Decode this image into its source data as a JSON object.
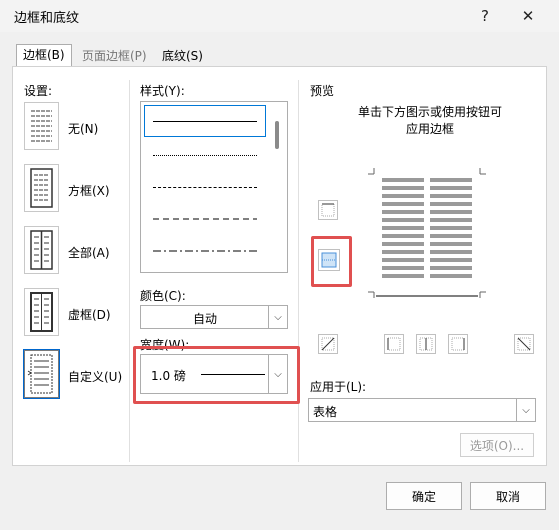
{
  "window": {
    "title": "边框和底纹",
    "help_glyph": "?",
    "close_glyph": "✕"
  },
  "tabs": [
    {
      "label": "边框(B)",
      "active": true
    },
    {
      "label": "页面边框(P)",
      "active": false
    },
    {
      "label": "底纹(S)",
      "active": false
    }
  ],
  "settings": {
    "label": "设置:",
    "items": [
      {
        "label": "无(N)",
        "icon": "setting-none-icon"
      },
      {
        "label": "方框(X)",
        "icon": "setting-box-icon"
      },
      {
        "label": "全部(A)",
        "icon": "setting-all-icon"
      },
      {
        "label": "虚框(D)",
        "icon": "setting-grid-icon"
      },
      {
        "label": "自定义(U)",
        "icon": "setting-custom-icon",
        "selected": true
      }
    ]
  },
  "style": {
    "label": "样式(Y):"
  },
  "color": {
    "label": "颜色(C):",
    "value": "自动"
  },
  "width": {
    "label": "宽度(W):",
    "value": "1.0 磅"
  },
  "preview": {
    "label": "预览",
    "hint_line1": "单击下方图示或使用按钮可",
    "hint_line2": "应用边框"
  },
  "apply_to": {
    "label": "应用于(L):",
    "value": "表格"
  },
  "options_button": "选项(O)...",
  "ok_button": "确定",
  "cancel_button": "取消",
  "colors": {
    "accent": "#0078d7",
    "highlight_red": "#e05050"
  }
}
